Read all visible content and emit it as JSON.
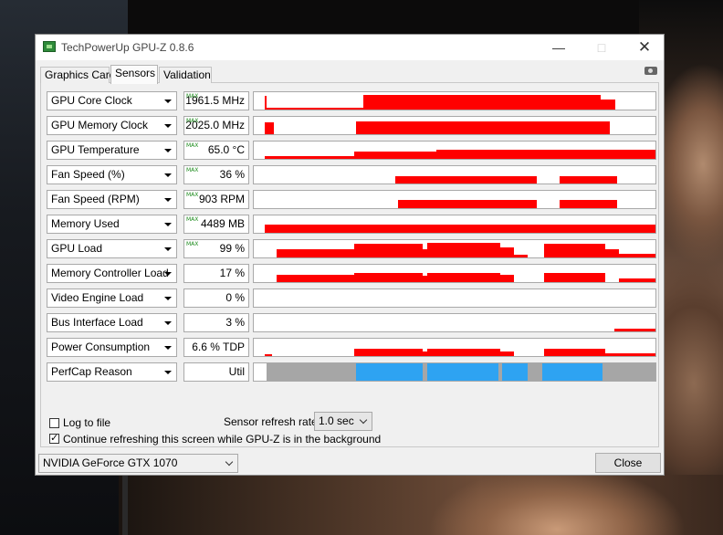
{
  "window": {
    "title": "TechPowerUp GPU-Z 0.8.6",
    "minimize_icon": "minimize-icon",
    "maximize_icon": "maximize-icon",
    "close_icon": "close-icon"
  },
  "tabs": [
    {
      "label": "Graphics Card",
      "active": false
    },
    {
      "label": "Sensors",
      "active": true
    },
    {
      "label": "Validation",
      "active": false
    }
  ],
  "screenshot_icon": "camera-icon",
  "max_badge": "MAX",
  "sensors": [
    {
      "name": "GPU Core Clock",
      "value": "1961.5 MHz",
      "max": true
    },
    {
      "name": "GPU Memory Clock",
      "value": "2025.0 MHz",
      "max": true
    },
    {
      "name": "GPU Temperature",
      "value": "65.0 °C",
      "max": true
    },
    {
      "name": "Fan Speed (%)",
      "value": "36 %",
      "max": true
    },
    {
      "name": "Fan Speed (RPM)",
      "value": "903 RPM",
      "max": true
    },
    {
      "name": "Memory Used",
      "value": "4489 MB",
      "max": true
    },
    {
      "name": "GPU Load",
      "value": "99 %",
      "max": true
    },
    {
      "name": "Memory Controller Load",
      "value": "17 %",
      "max": false
    },
    {
      "name": "Video Engine Load",
      "value": "0 %",
      "max": false
    },
    {
      "name": "Bus Interface Load",
      "value": "3 %",
      "max": false
    },
    {
      "name": "Power Consumption",
      "value": "6.6 % TDP",
      "max": false
    },
    {
      "name": "PerfCap Reason",
      "value": "Util",
      "max": false
    }
  ],
  "colors": {
    "graph": "#ff0000",
    "perfcap_idle": "#a6a6a6",
    "perfcap_util": "#2ea3f2"
  },
  "options": {
    "log_to_file": {
      "label": "Log to file",
      "checked": false
    },
    "continue_refresh": {
      "label": "Continue refreshing this screen while GPU-Z is in the background",
      "checked": true
    },
    "refresh_rate_label": "Sensor refresh rate:",
    "refresh_rate_value": "1.0 sec"
  },
  "footer": {
    "gpu_select": "NVIDIA GeForce GTX 1070",
    "close_label": "Close"
  }
}
